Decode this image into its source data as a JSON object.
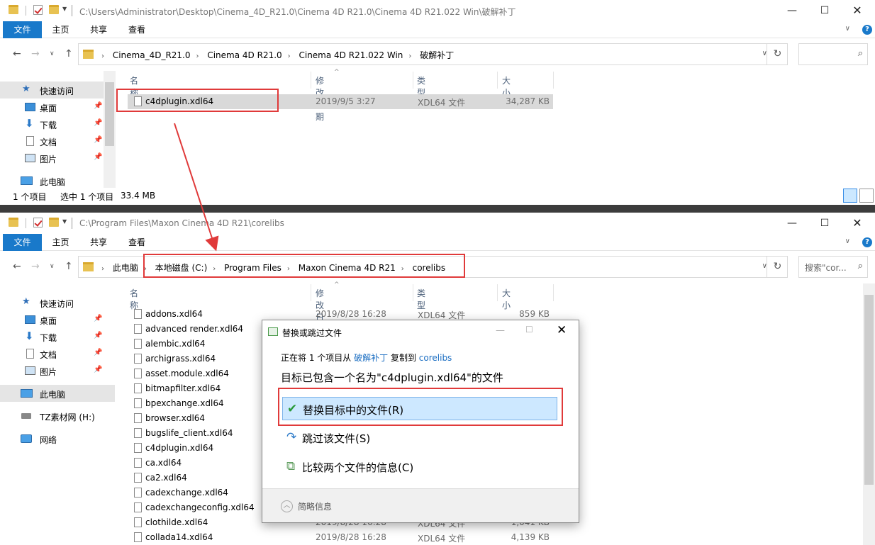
{
  "top_window": {
    "title": "C:\\Users\\Administrator\\Desktop\\Cinema_4D_R21.0\\Cinema 4D R21.0\\Cinema 4D R21.022 Win\\破解补丁",
    "ribbon": {
      "file": "文件",
      "home": "主页",
      "share": "共享",
      "view": "查看"
    },
    "breadcrumbs": [
      "Cinema_4D_R21.0",
      "Cinema 4D R21.0",
      "Cinema 4D R21.022 Win",
      "破解补丁"
    ],
    "search_placeholder": "",
    "columns": {
      "name": "名称",
      "date": "修改日期",
      "type": "类型",
      "size": "大小"
    },
    "sidebar": [
      {
        "label": "快速访问",
        "icon": "star-icon"
      },
      {
        "label": "桌面",
        "icon": "desktop-icon"
      },
      {
        "label": "下载",
        "icon": "download-icon"
      },
      {
        "label": "文档",
        "icon": "document-icon"
      },
      {
        "label": "图片",
        "icon": "pictures-icon"
      },
      {
        "label": "此电脑",
        "icon": "computer-icon"
      }
    ],
    "files": [
      {
        "name": "c4dplugin.xdl64",
        "date": "2019/9/5 3:27",
        "type": "XDL64 文件",
        "size": "34,287 KB"
      }
    ],
    "status": {
      "count": "1 个项目",
      "selected": "选中 1 个项目",
      "size": "33.4 MB"
    }
  },
  "bottom_window": {
    "title": "C:\\Program Files\\Maxon Cinema 4D R21\\corelibs",
    "ribbon": {
      "file": "文件",
      "home": "主页",
      "share": "共享",
      "view": "查看"
    },
    "breadcrumbs": [
      "此电脑",
      "本地磁盘 (C:)",
      "Program Files",
      "Maxon Cinema 4D R21",
      "corelibs"
    ],
    "search_placeholder": "搜索\"cor...",
    "columns": {
      "name": "名称",
      "date": "修改日期",
      "type": "类型",
      "size": "大小"
    },
    "sidebar": [
      {
        "label": "快速访问",
        "icon": "star-icon"
      },
      {
        "label": "桌面",
        "icon": "desktop-icon"
      },
      {
        "label": "下载",
        "icon": "download-icon"
      },
      {
        "label": "文档",
        "icon": "document-icon"
      },
      {
        "label": "图片",
        "icon": "pictures-icon"
      },
      {
        "label": "此电脑",
        "icon": "computer-icon"
      },
      {
        "label": "TZ素材网 (H:)",
        "icon": "drive-icon"
      },
      {
        "label": "网络",
        "icon": "network-icon"
      }
    ],
    "files": [
      {
        "name": "addons.xdl64",
        "date": "2019/8/28 16:28",
        "type": "XDL64 文件",
        "size": "859 KB"
      },
      {
        "name": "advanced render.xdl64",
        "date": "",
        "type": "",
        "size": ""
      },
      {
        "name": "alembic.xdl64",
        "date": "",
        "type": "",
        "size": ""
      },
      {
        "name": "archigrass.xdl64",
        "date": "",
        "type": "",
        "size": ""
      },
      {
        "name": "asset.module.xdl64",
        "date": "",
        "type": "",
        "size": ""
      },
      {
        "name": "bitmapfilter.xdl64",
        "date": "",
        "type": "",
        "size": ""
      },
      {
        "name": "bpexchange.xdl64",
        "date": "",
        "type": "",
        "size": ""
      },
      {
        "name": "browser.xdl64",
        "date": "",
        "type": "",
        "size": ""
      },
      {
        "name": "bugslife_client.xdl64",
        "date": "",
        "type": "",
        "size": ""
      },
      {
        "name": "c4dplugin.xdl64",
        "date": "",
        "type": "",
        "size": ""
      },
      {
        "name": "ca.xdl64",
        "date": "",
        "type": "",
        "size": ""
      },
      {
        "name": "ca2.xdl64",
        "date": "",
        "type": "",
        "size": ""
      },
      {
        "name": "cadexchange.xdl64",
        "date": "",
        "type": "",
        "size": ""
      },
      {
        "name": "cadexchangeconfig.xdl64",
        "date": "",
        "type": "",
        "size": ""
      },
      {
        "name": "clothilde.xdl64",
        "date": "2019/8/28 16:28",
        "type": "XDL64 文件",
        "size": "1,041 KB"
      },
      {
        "name": "collada14.xdl64",
        "date": "2019/8/28 16:28",
        "type": "XDL64 文件",
        "size": "4,139 KB"
      }
    ]
  },
  "dialog": {
    "title": "替换或跳过文件",
    "info_prefix": "正在将 1 个项目从",
    "info_source": "破解补丁",
    "info_mid": "复制到",
    "info_dest": "corelibs",
    "heading": "目标已包含一个名为\"c4dplugin.xdl64\"的文件",
    "option_replace": "替换目标中的文件(R)",
    "option_skip": "跳过该文件(S)",
    "option_compare": "比较两个文件的信息(C)",
    "footer": "简略信息"
  },
  "colors": {
    "accent": "#1979ca",
    "highlight": "#e03a3a",
    "selection": "#cde8ff"
  }
}
